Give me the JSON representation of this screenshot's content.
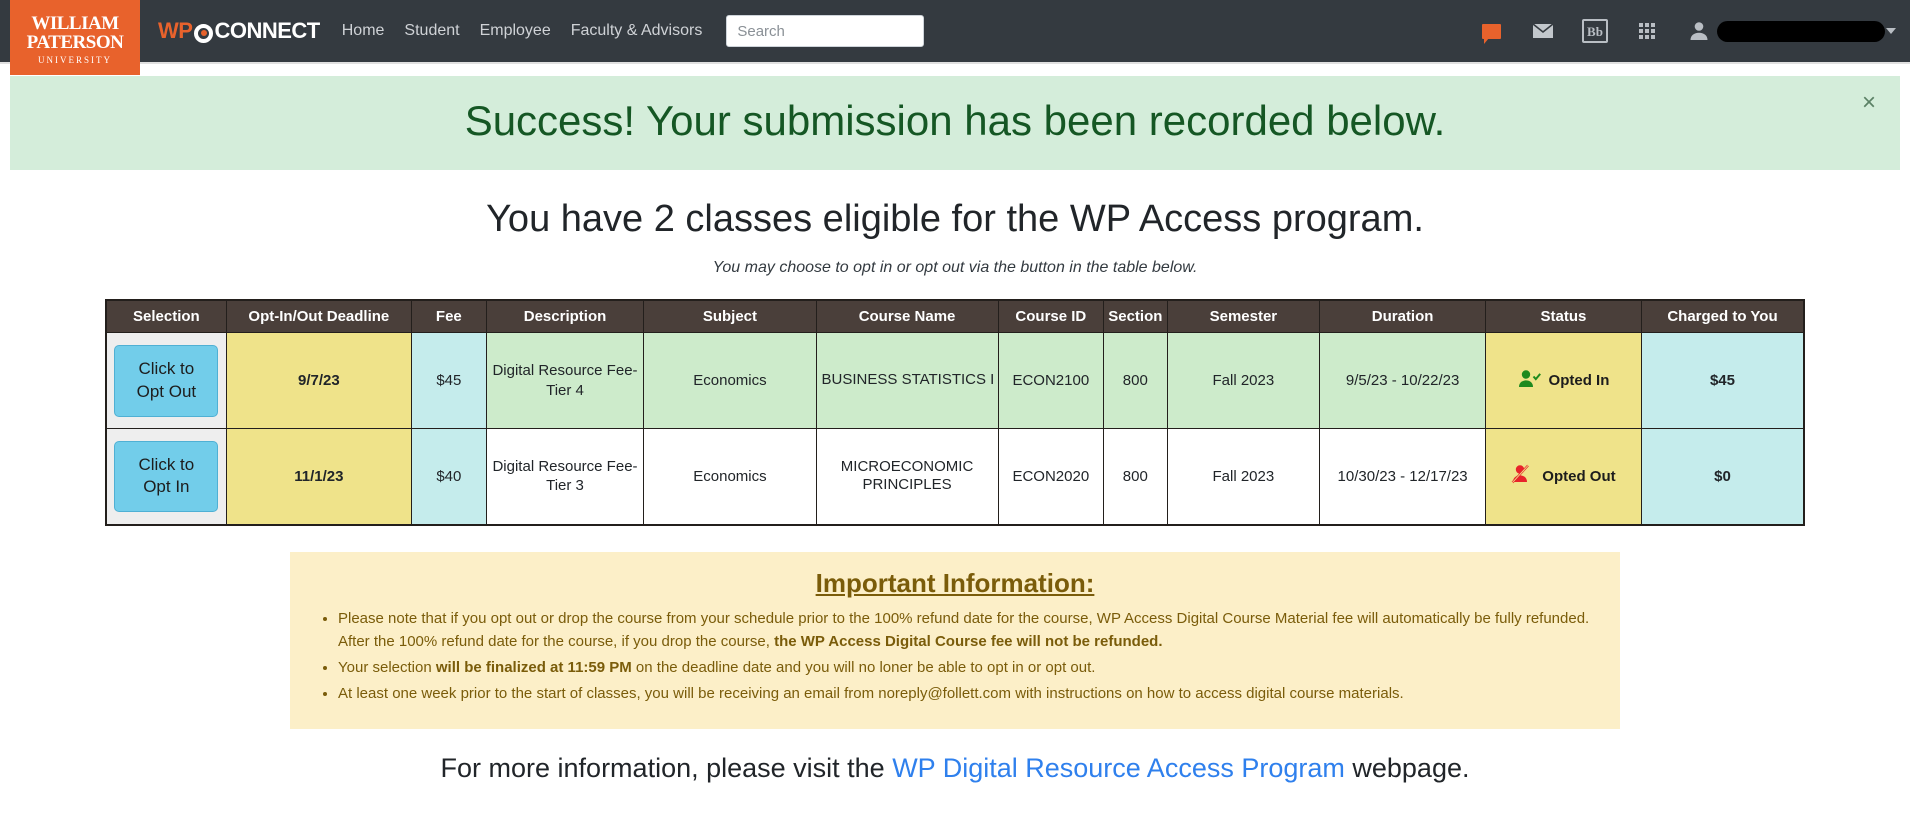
{
  "navbar": {
    "logo": {
      "line1": "WILLIAM",
      "line2": "PATERSON",
      "line3": "UNIVERSITY"
    },
    "brand": {
      "wp": "WP",
      "connect": "CONNECT"
    },
    "links": [
      {
        "label": "Home"
      },
      {
        "label": "Student"
      },
      {
        "label": "Employee"
      },
      {
        "label": "Faculty & Advisors"
      }
    ],
    "search": {
      "placeholder": "Search",
      "value": ""
    },
    "icons": [
      {
        "name": "chat-icon",
        "color": "#e8622c"
      },
      {
        "name": "envelope-icon",
        "color": "#b9bec4"
      },
      {
        "name": "blackboard-icon",
        "label": "Bb",
        "color": "#b9bec4"
      },
      {
        "name": "apps-grid-icon",
        "color": "#b9bec4"
      },
      {
        "name": "user-avatar-icon",
        "color": "#b9bec4"
      }
    ],
    "user_name_redacted": ""
  },
  "alert": {
    "message": "Success! Your submission has been recorded below.",
    "close_label": "×",
    "background": "#d4edda",
    "text_color": "#155724"
  },
  "page": {
    "title": "You have 2 classes eligible for the WP Access program.",
    "subtitle": "You may choose to opt in or opt out via the button in the table below."
  },
  "table": {
    "columns": [
      "Selection",
      "Opt-In/Out Deadline",
      "Fee",
      "Description",
      "Subject",
      "Course Name",
      "Course ID",
      "Section",
      "Semester",
      "Duration",
      "Status",
      "Charged to You"
    ],
    "rows": [
      {
        "button_label_line1": "Click to",
        "button_label_line2": "Opt Out",
        "deadline": "9/7/23",
        "fee": "$45",
        "description": "Digital Resource Fee-Tier 4",
        "subject": "Economics",
        "course_name": "BUSINESS STATISTICS I",
        "course_id": "ECON2100",
        "section": "800",
        "semester": "Fall 2023",
        "duration": "9/5/23 - 10/22/23",
        "status": "Opted In",
        "status_icon": "user-check-icon",
        "status_color": "#1e8a1e",
        "charged": "$45"
      },
      {
        "button_label_line1": "Click to",
        "button_label_line2": "Opt In",
        "deadline": "11/1/23",
        "fee": "$40",
        "description": "Digital Resource Fee-Tier 3",
        "subject": "Economics",
        "course_name": "MICROECONOMIC PRINCIPLES",
        "course_id": "ECON2020",
        "section": "800",
        "semester": "Fall 2023",
        "duration": "10/30/23 - 12/17/23",
        "status": "Opted Out",
        "status_icon": "user-slash-icon",
        "status_color": "#e8232a",
        "charged": "$0"
      }
    ]
  },
  "info": {
    "title": "Important Information:",
    "bullets": [
      {
        "part1": "Please note that if you opt out or drop the course from your schedule prior to the 100% refund date for the course, WP Access Digital Course Material fee will automatically be fully refunded. After the 100% refund date for the course, if you drop the course, ",
        "bold": "the WP Access Digital Course fee will not be refunded.",
        "part2": ""
      },
      {
        "part1": "Your selection ",
        "bold": "will be finalized at 11:59 PM",
        "part2": " on the deadline date and you will no loner be able to opt in or opt out."
      },
      {
        "part1": "At least one week prior to the start of classes, you will be receiving an email from noreply@follett.com with instructions on how to access digital course materials.",
        "bold": "",
        "part2": ""
      }
    ]
  },
  "footer": {
    "before": "For more information, please visit the ",
    "link": "WP Digital Resource Access Program",
    "after": " webpage."
  }
}
